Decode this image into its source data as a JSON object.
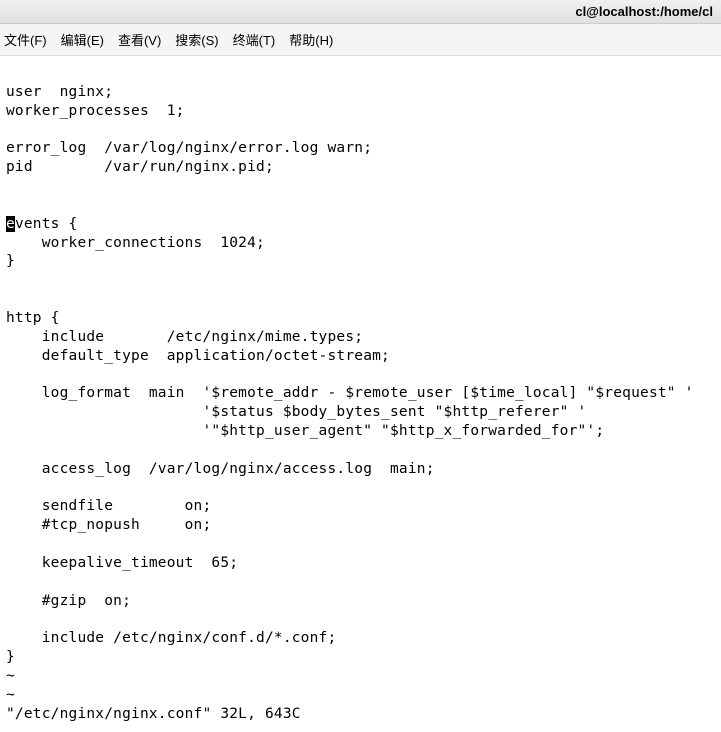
{
  "titlebar": {
    "title": "cl@localhost:/home/cl"
  },
  "menubar": {
    "items": [
      {
        "label": "文件(F)"
      },
      {
        "label": "编辑(E)"
      },
      {
        "label": "查看(V)"
      },
      {
        "label": "搜索(S)"
      },
      {
        "label": "终端(T)"
      },
      {
        "label": "帮助(H)"
      }
    ]
  },
  "terminal": {
    "lines": [
      "",
      "user  nginx;",
      "worker_processes  1;",
      "",
      "error_log  /var/log/nginx/error.log warn;",
      "pid        /var/run/nginx.pid;",
      "",
      "",
      "",
      "    worker_connections  1024;",
      "}",
      "",
      "",
      "http {",
      "    include       /etc/nginx/mime.types;",
      "    default_type  application/octet-stream;",
      "",
      "    log_format  main  '$remote_addr - $remote_user [$time_local] \"$request\" '",
      "                      '$status $body_bytes_sent \"$http_referer\" '",
      "                      '\"$http_user_agent\" \"$http_x_forwarded_for\"';",
      "",
      "    access_log  /var/log/nginx/access.log  main;",
      "",
      "    sendfile        on;",
      "    #tcp_nopush     on;",
      "",
      "    keepalive_timeout  65;",
      "",
      "    #gzip  on;",
      "",
      "    include /etc/nginx/conf.d/*.conf;",
      "}"
    ],
    "cursor_line": {
      "before_cursor": "",
      "cursor_char": "e",
      "after_cursor": "vents {"
    },
    "tilde": "~",
    "status_line": "\"/etc/nginx/nginx.conf\" 32L, 643C"
  }
}
